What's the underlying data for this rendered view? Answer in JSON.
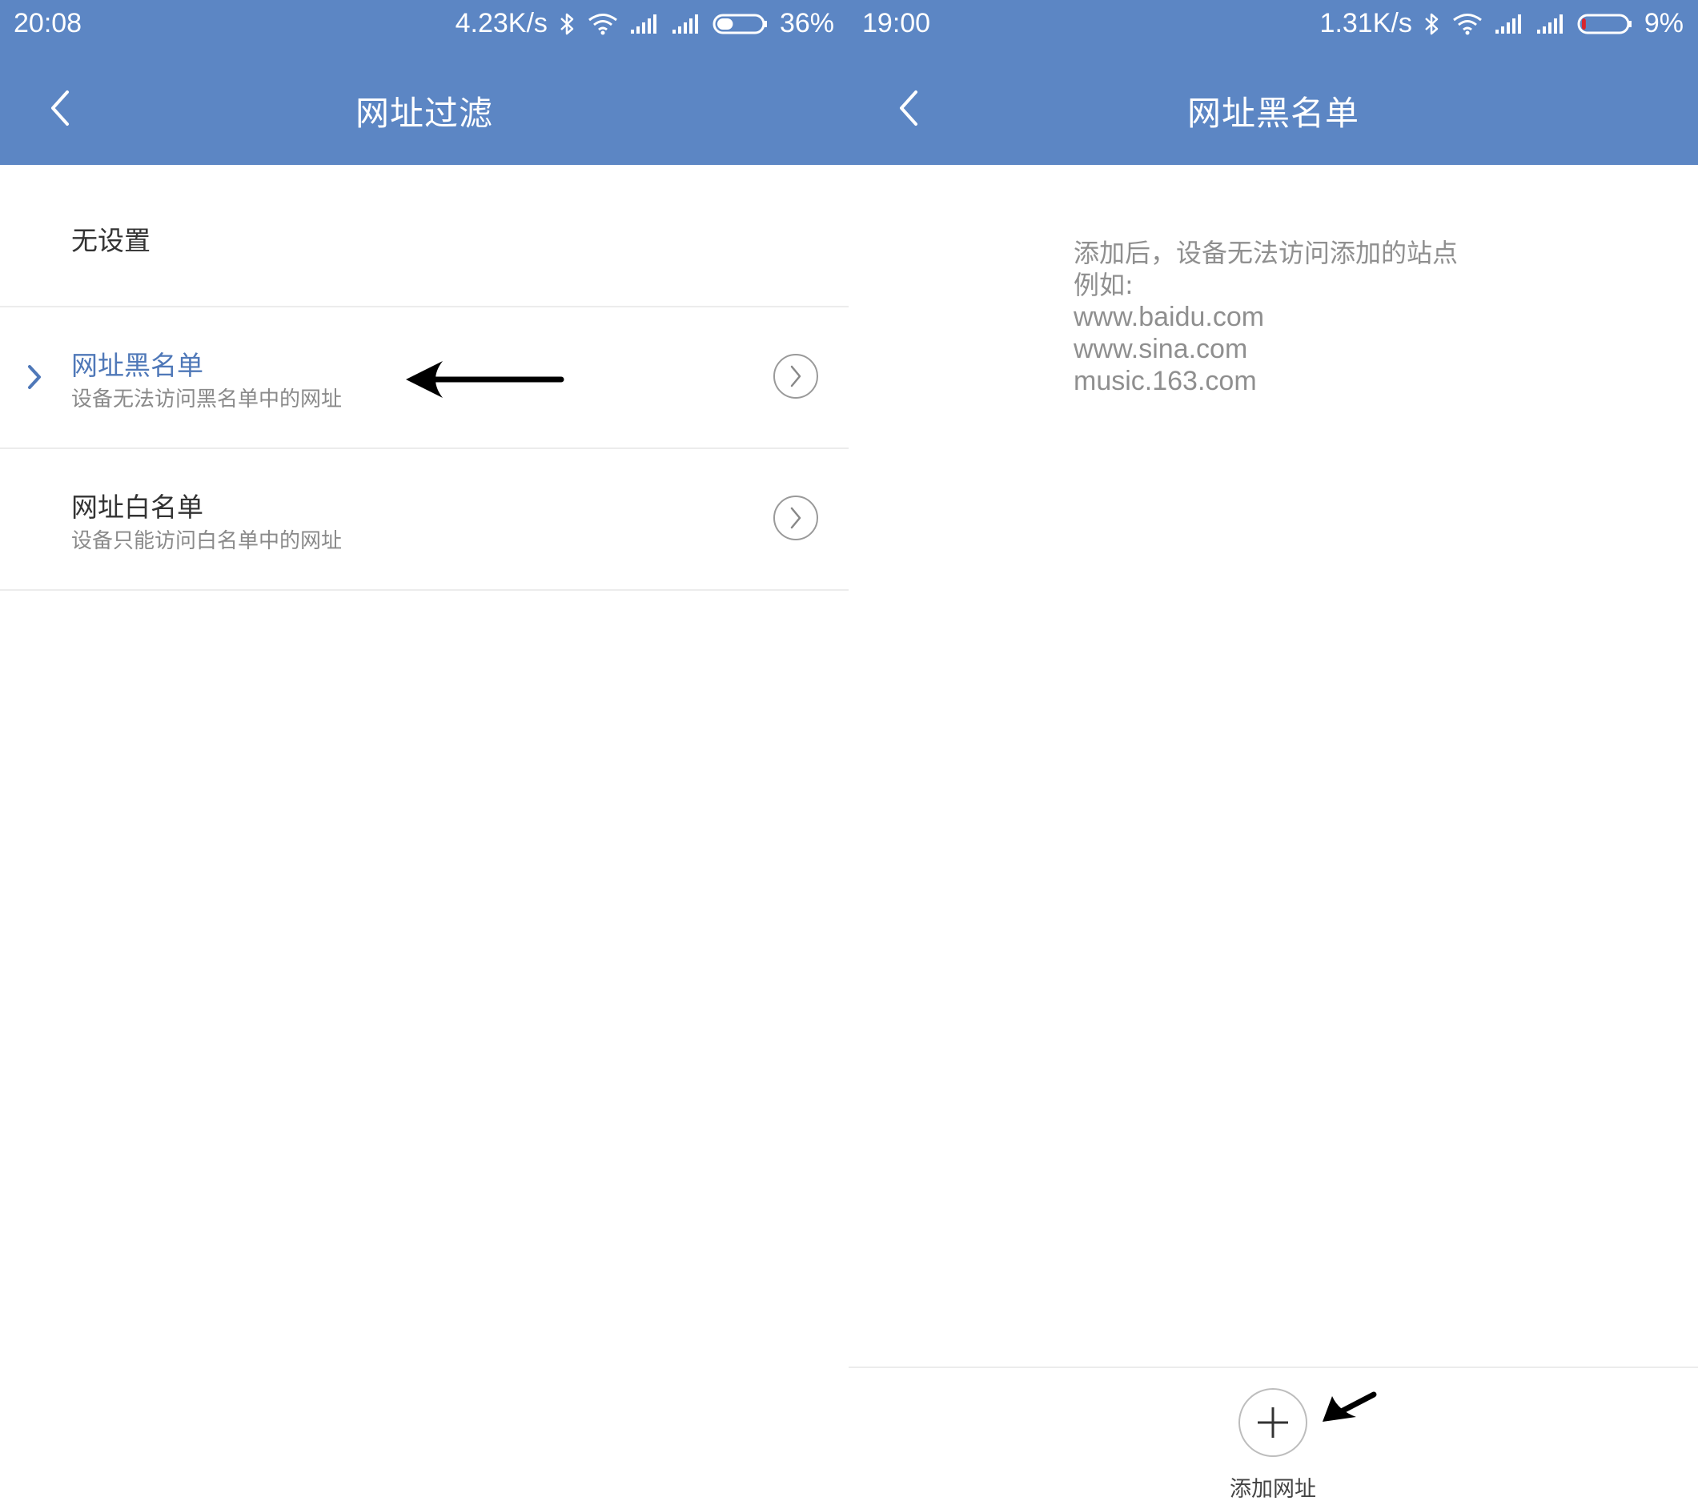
{
  "theme": {
    "bar_color": "#5c86c4",
    "accent_color": "#4f78b8"
  },
  "left_screen": {
    "status_bar": {
      "time": "20:08",
      "speed": "4.23K/s",
      "battery": "36%",
      "battery_level": 0.36
    },
    "title": "网址过滤",
    "options": [
      {
        "label": "无设置"
      },
      {
        "label": "网址黑名单",
        "description": "设备无法访问黑名单中的网址",
        "selected": true
      },
      {
        "label": "网址白名单",
        "description": "设备只能访问白名单中的网址"
      }
    ]
  },
  "right_screen": {
    "status_bar": {
      "time": "19:00",
      "speed": "1.31K/s",
      "battery": "9%",
      "battery_level": 0.09
    },
    "title": "网址黑名单",
    "hint": {
      "line1": "添加后，设备无法访问添加的站点",
      "line2": "例如:",
      "examples": [
        "www.baidu.com",
        "www.sina.com",
        "music.163.com"
      ]
    },
    "add_button_label": "添加网址"
  }
}
